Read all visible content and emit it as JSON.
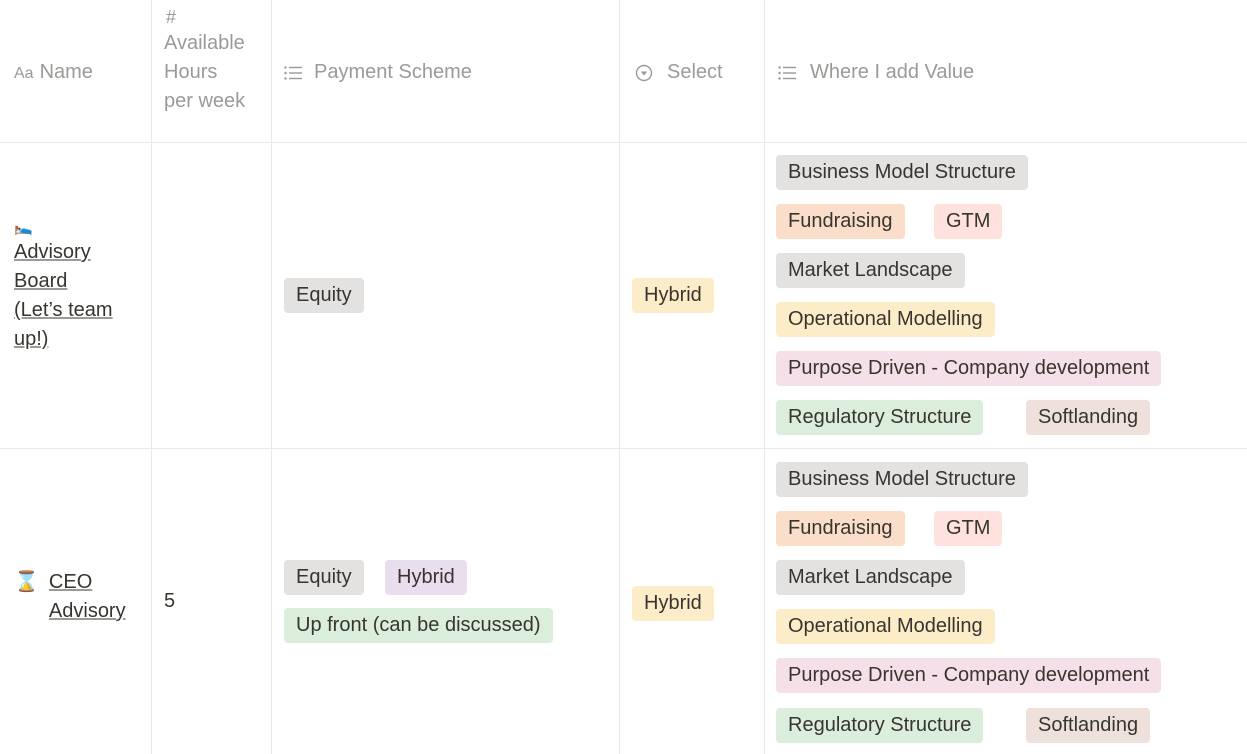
{
  "columns": {
    "name": {
      "icon": "text-type-icon",
      "icon_text": "Aa",
      "label": "Name"
    },
    "hours": {
      "icon": "number-icon",
      "icon_text": "#",
      "label_lines": [
        "Available",
        "Hours",
        "per week"
      ]
    },
    "payment": {
      "icon": "multi-select-icon",
      "label": "Payment Scheme"
    },
    "select": {
      "icon": "select-icon",
      "label": "Select"
    },
    "value": {
      "icon": "multi-select-icon",
      "label": "Where I add Value"
    }
  },
  "colors": {
    "gray": "#e3e2e0",
    "orange": "#fadec9",
    "red": "#ffe2dd",
    "yellow": "#fdecc8",
    "pink": "#f5e0e9",
    "green": "#dbeddb",
    "brown": "#eee0da",
    "purple": "#e8deee"
  },
  "rows": [
    {
      "emoji": "🛌",
      "emoji_name": "bed-emoji-icon",
      "name_lines": [
        "Advisory",
        "Board",
        "(Let’s team",
        "up!)"
      ],
      "hours": "",
      "payment": [
        {
          "label": "Equity",
          "color": "gray"
        }
      ],
      "select": {
        "label": "Hybrid",
        "color": "yellow"
      },
      "value": [
        {
          "label": "Business Model Structure",
          "color": "gray"
        },
        {
          "label": "Fundraising",
          "color": "orange"
        },
        {
          "label": "GTM",
          "color": "red"
        },
        {
          "label": "Market Landscape",
          "color": "gray"
        },
        {
          "label": "Operational Modelling",
          "color": "yellow"
        },
        {
          "label": "Purpose Driven - Company development",
          "color": "pink"
        },
        {
          "label": "Regulatory Structure",
          "color": "green"
        },
        {
          "label": "Softlanding",
          "color": "brown"
        }
      ]
    },
    {
      "emoji": "⌛",
      "emoji_name": "hourglass-emoji-icon",
      "name_lines": [
        "CEO",
        "Advisory"
      ],
      "hours": "5",
      "payment": [
        {
          "label": "Equity",
          "color": "gray"
        },
        {
          "label": "Hybrid",
          "color": "purple"
        },
        {
          "label": "Up front (can be discussed)",
          "color": "green"
        }
      ],
      "select": {
        "label": "Hybrid",
        "color": "yellow"
      },
      "value": [
        {
          "label": "Business Model Structure",
          "color": "gray"
        },
        {
          "label": "Fundraising",
          "color": "orange"
        },
        {
          "label": "GTM",
          "color": "red"
        },
        {
          "label": "Market Landscape",
          "color": "gray"
        },
        {
          "label": "Operational Modelling",
          "color": "yellow"
        },
        {
          "label": "Purpose Driven - Company development",
          "color": "pink"
        },
        {
          "label": "Regulatory Structure",
          "color": "green"
        },
        {
          "label": "Softlanding",
          "color": "brown"
        }
      ]
    }
  ]
}
